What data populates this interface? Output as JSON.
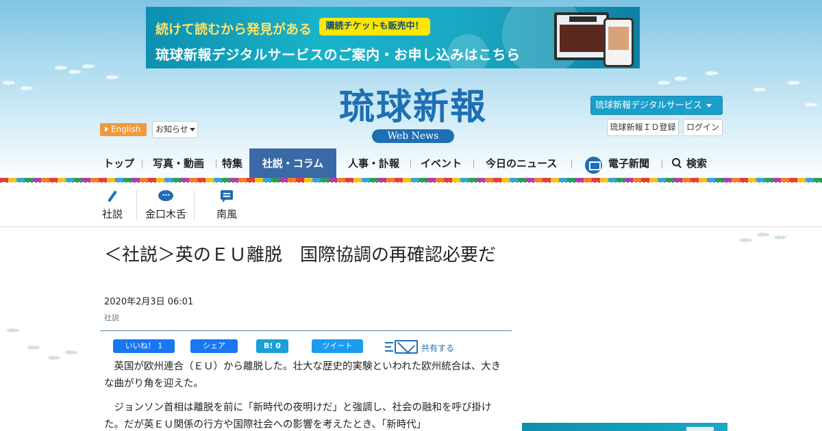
{
  "banner": {
    "line1": "続けて読むから発見がある",
    "pill": "購読チケットも販売中！",
    "line2": "琉球新報デジタルサービスのご案内・お申し込みはこちら"
  },
  "logo": {
    "main": "琉球新報",
    "sub": "Web News"
  },
  "header": {
    "english_label": "English",
    "notice_label": "お知らせ",
    "digital_label": "琉球新報デジタルサービス",
    "idreg_label": "琉球新報ＩＤ登録",
    "login_label": "ログイン"
  },
  "nav": {
    "items": [
      {
        "label": "トップ"
      },
      {
        "label": "写真・動画"
      },
      {
        "label": "特集"
      },
      {
        "label": "社説・コラム"
      },
      {
        "label": "人事・訃報"
      },
      {
        "label": "イベント"
      },
      {
        "label": "今日のニュース"
      },
      {
        "label": "電子新聞"
      },
      {
        "label": "検索"
      }
    ],
    "active_index": 3
  },
  "subnav": {
    "items": [
      {
        "label": "社説",
        "icon": "pen-icon"
      },
      {
        "label": "金口木舌",
        "icon": "speech-bubble-icon"
      },
      {
        "label": "南風",
        "icon": "memo-icon"
      }
    ]
  },
  "article": {
    "title": "＜社説＞英のＥＵ離脱　国際協調の再確認必要だ",
    "date": "2020年2月3日 06:01",
    "category": "社説",
    "paragraphs": [
      "英国が欧州連合（ＥＵ）から離脱した。壮大な歴史的実験といわれた欧州統合は、大きな曲がり角を迎えた。",
      "ジョンソン首相は離脱を前に「新時代の夜明けだ」と強調し、社会の融和を呼び掛けた。だが英ＥＵ関係の行方や国際社会への影響を考えたとき、「新時代」"
    ]
  },
  "share": {
    "fb_like": "いいね！ 1",
    "fb_share": "シェア",
    "hatena": "B! 0",
    "tweet": "ツイート",
    "share_label": "共有する"
  },
  "colors": {
    "brand_blue": "#1e6fb3",
    "nav_active": "#3a6aa5",
    "english_orange": "#f0993b",
    "digital_button": "#1a9fcb"
  }
}
